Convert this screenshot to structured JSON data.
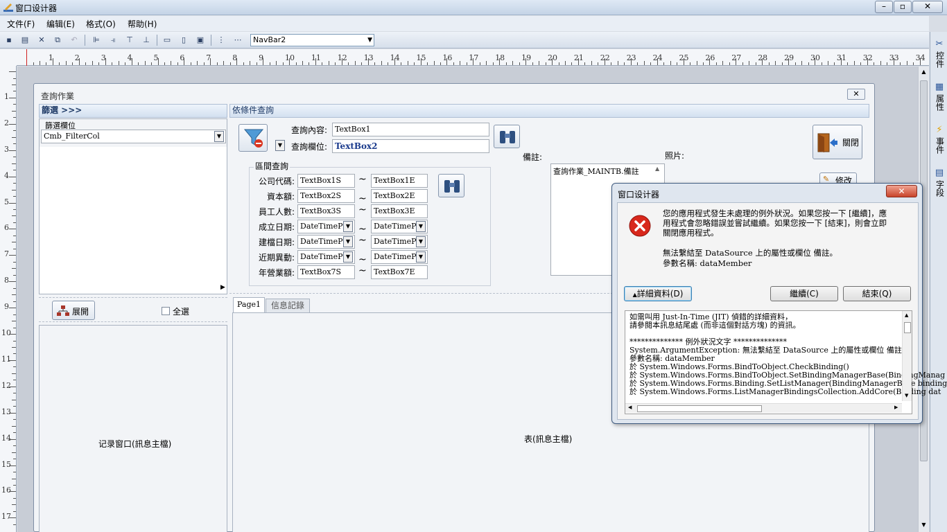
{
  "window": {
    "title": "窗口设计器"
  },
  "menu": [
    "文件(F)",
    "编辑(E)",
    "格式(O)",
    "帮助(H)"
  ],
  "toolbar": {
    "object_combo": "NavBar2"
  },
  "dock": [
    "控件",
    "属性",
    "事件",
    "字段"
  ],
  "ruler": {
    "h": [
      "1",
      "2",
      "3",
      "4",
      "5",
      "6",
      "7",
      "8",
      "9",
      "10",
      "11",
      "12",
      "13",
      "14",
      "15",
      "16",
      "17",
      "18",
      "19",
      "20",
      "21",
      "22",
      "23",
      "24",
      "25",
      "26",
      "27",
      "28",
      "29",
      "30",
      "31",
      "32",
      "33",
      "34"
    ],
    "v": [
      "1",
      "2",
      "3",
      "4",
      "5",
      "6",
      "7",
      "8",
      "9",
      "10",
      "11",
      "12",
      "13",
      "14",
      "15",
      "16",
      "17"
    ]
  },
  "form": {
    "title": "查詢作業",
    "filter": {
      "head": "篩選 >>>",
      "field_label": "篩選欄位",
      "field_value": "Cmb_FilterCol",
      "expand": "展開",
      "select_all": "全選",
      "records": "记录窗口(訊息主檔)"
    },
    "query": {
      "head": "依條件查詢",
      "content_label": "查詢內容:",
      "content_value": "TextBox1",
      "column_label": "查詢欄位:",
      "column_value": "TextBox2",
      "range_title": "區間查詢",
      "rows": [
        {
          "label": "公司代碼:",
          "from": "TextBox1S",
          "to": "TextBox1E"
        },
        {
          "label": "資本額:",
          "from": "TextBox2S",
          "to": "TextBox2E"
        },
        {
          "label": "員工人數:",
          "from": "TextBox3S",
          "to": "TextBox3E"
        },
        {
          "label": "成立日期:",
          "from": "DateTimePic",
          "to": "DateTimePic"
        },
        {
          "label": "建檔日期:",
          "from": "DateTimePic",
          "to": "DateTimePic"
        },
        {
          "label": "近期異動:",
          "from": "DateTimePic",
          "to": "DateTimePic"
        },
        {
          "label": "年營業額:",
          "from": "TextBox7S",
          "to": "TextBox7E"
        }
      ],
      "tilde": "~",
      "note_label": "備註:",
      "note_value": "查詢作業_MAINTB.備註",
      "photo_label": "照片:",
      "close": "關閉",
      "modify": "修改",
      "tabs": [
        "Page1",
        "信息記錄"
      ],
      "table": "表(訊息主檔)"
    }
  },
  "dialog": {
    "title": "窗口设计器",
    "message_lines": [
      "您的應用程式發生未處理的例外狀況。如果您按一下 [繼續]，應",
      "用程式會忽略錯誤並嘗試繼續。如果您按一下 [結束]，則會立即",
      "關閉應用程式。"
    ],
    "error_line": "無法繫結至 DataSource 上的屬性或欄位 備註。",
    "param_line": "參數名稱: dataMember",
    "details_button": "詳細資料(D)",
    "continue_button": "繼續(C)",
    "quit_button": "結束(Q)",
    "details": [
      "如需叫用 Just-In-Time (JIT) 偵錯的詳細資料，",
      "請參閱本訊息結尾處 (而非這個對話方塊) 的資訊。",
      "",
      "************** 例外狀況文字 **************",
      "System.ArgumentException: 無法繫結至 DataSource 上的屬性或欄位 備註。",
      "參數名稱: dataMember",
      "   於 System.Windows.Forms.BindToObject.CheckBinding()",
      "   於 System.Windows.Forms.BindToObject.SetBindingManagerBase(BindingManag",
      "   於 System.Windows.Forms.Binding.SetListManager(BindingManagerBase binding",
      "   於 System.Windows.Forms.ListManagerBindingsCollection.AddCore(Binding dat"
    ]
  }
}
